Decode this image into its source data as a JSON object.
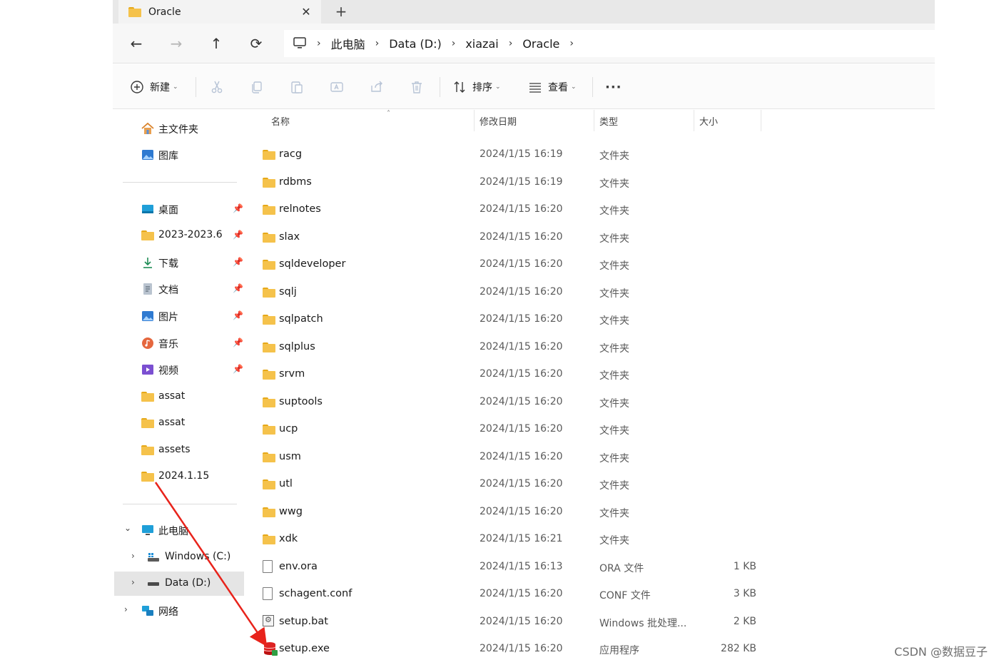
{
  "tab": {
    "title": "Oracle",
    "close_glyph": "✕",
    "new_glyph": "+"
  },
  "nav": {
    "back": "←",
    "forward": "→",
    "up": "↑",
    "refresh": "⟳"
  },
  "breadcrumb": [
    "此电脑",
    "Data (D:)",
    "xiazai",
    "Oracle"
  ],
  "breadcrumb_sep": "›",
  "toolbar": {
    "new_label": "新建",
    "sort_label": "排序",
    "view_label": "查看",
    "more_glyph": "···",
    "caret": "⌄",
    "icons": {
      "new": "plus-circle-icon",
      "cut": "scissors-icon",
      "copy": "copy-icon",
      "paste": "paste-icon",
      "rename": "rename-icon",
      "share": "share-icon",
      "delete": "trash-icon",
      "sort": "sort-icon",
      "view": "list-view-icon"
    }
  },
  "sidebar": {
    "quick": [
      {
        "label": "主文件夹",
        "icon": "home-icon"
      },
      {
        "label": "图库",
        "icon": "gallery-icon"
      }
    ],
    "pinned": [
      {
        "label": "桌面",
        "icon": "desktop-icon"
      },
      {
        "label": "2023-2023.6",
        "icon": "folder-icon"
      },
      {
        "label": "下载",
        "icon": "download-icon"
      },
      {
        "label": "文档",
        "icon": "documents-icon"
      },
      {
        "label": "图片",
        "icon": "pictures-icon"
      },
      {
        "label": "音乐",
        "icon": "music-icon"
      },
      {
        "label": "视频",
        "icon": "videos-icon"
      },
      {
        "label": "assat",
        "icon": "folder-icon"
      },
      {
        "label": "assat",
        "icon": "folder-icon"
      },
      {
        "label": "assets",
        "icon": "folder-icon"
      },
      {
        "label": "2024.1.15",
        "icon": "folder-icon"
      }
    ],
    "pin_glyph": "📌",
    "this_pc": "此电脑",
    "drives": [
      {
        "label": "Windows (C:)",
        "icon": "drive-c-icon"
      },
      {
        "label": "Data (D:)",
        "icon": "drive-d-icon"
      }
    ],
    "network": "网络",
    "chev_open": "⌄",
    "chev_closed": "›"
  },
  "columns": {
    "name": "名称",
    "date": "修改日期",
    "type": "类型",
    "size": "大小",
    "sort_indicator": "˄"
  },
  "files": [
    {
      "name": "racg",
      "date": "2024/1/15 16:19",
      "type": "文件夹",
      "size": "",
      "kind": "folder"
    },
    {
      "name": "rdbms",
      "date": "2024/1/15 16:19",
      "type": "文件夹",
      "size": "",
      "kind": "folder"
    },
    {
      "name": "relnotes",
      "date": "2024/1/15 16:20",
      "type": "文件夹",
      "size": "",
      "kind": "folder"
    },
    {
      "name": "slax",
      "date": "2024/1/15 16:20",
      "type": "文件夹",
      "size": "",
      "kind": "folder"
    },
    {
      "name": "sqldeveloper",
      "date": "2024/1/15 16:20",
      "type": "文件夹",
      "size": "",
      "kind": "folder"
    },
    {
      "name": "sqlj",
      "date": "2024/1/15 16:20",
      "type": "文件夹",
      "size": "",
      "kind": "folder"
    },
    {
      "name": "sqlpatch",
      "date": "2024/1/15 16:20",
      "type": "文件夹",
      "size": "",
      "kind": "folder"
    },
    {
      "name": "sqlplus",
      "date": "2024/1/15 16:20",
      "type": "文件夹",
      "size": "",
      "kind": "folder"
    },
    {
      "name": "srvm",
      "date": "2024/1/15 16:20",
      "type": "文件夹",
      "size": "",
      "kind": "folder"
    },
    {
      "name": "suptools",
      "date": "2024/1/15 16:20",
      "type": "文件夹",
      "size": "",
      "kind": "folder"
    },
    {
      "name": "ucp",
      "date": "2024/1/15 16:20",
      "type": "文件夹",
      "size": "",
      "kind": "folder"
    },
    {
      "name": "usm",
      "date": "2024/1/15 16:20",
      "type": "文件夹",
      "size": "",
      "kind": "folder"
    },
    {
      "name": "utl",
      "date": "2024/1/15 16:20",
      "type": "文件夹",
      "size": "",
      "kind": "folder"
    },
    {
      "name": "wwg",
      "date": "2024/1/15 16:20",
      "type": "文件夹",
      "size": "",
      "kind": "folder"
    },
    {
      "name": "xdk",
      "date": "2024/1/15 16:21",
      "type": "文件夹",
      "size": "",
      "kind": "folder"
    },
    {
      "name": "env.ora",
      "date": "2024/1/15 16:13",
      "type": "ORA 文件",
      "size": "1 KB",
      "kind": "doc"
    },
    {
      "name": "schagent.conf",
      "date": "2024/1/15 16:20",
      "type": "CONF 文件",
      "size": "3 KB",
      "kind": "doc"
    },
    {
      "name": "setup.bat",
      "date": "2024/1/15 16:20",
      "type": "Windows 批处理...",
      "size": "2 KB",
      "kind": "bat"
    },
    {
      "name": "setup.exe",
      "date": "2024/1/15 16:20",
      "type": "应用程序",
      "size": "282 KB",
      "kind": "exe"
    }
  ],
  "annotation": {
    "arrow_color": "#e8231b"
  },
  "watermark": "CSDN @数据豆子"
}
